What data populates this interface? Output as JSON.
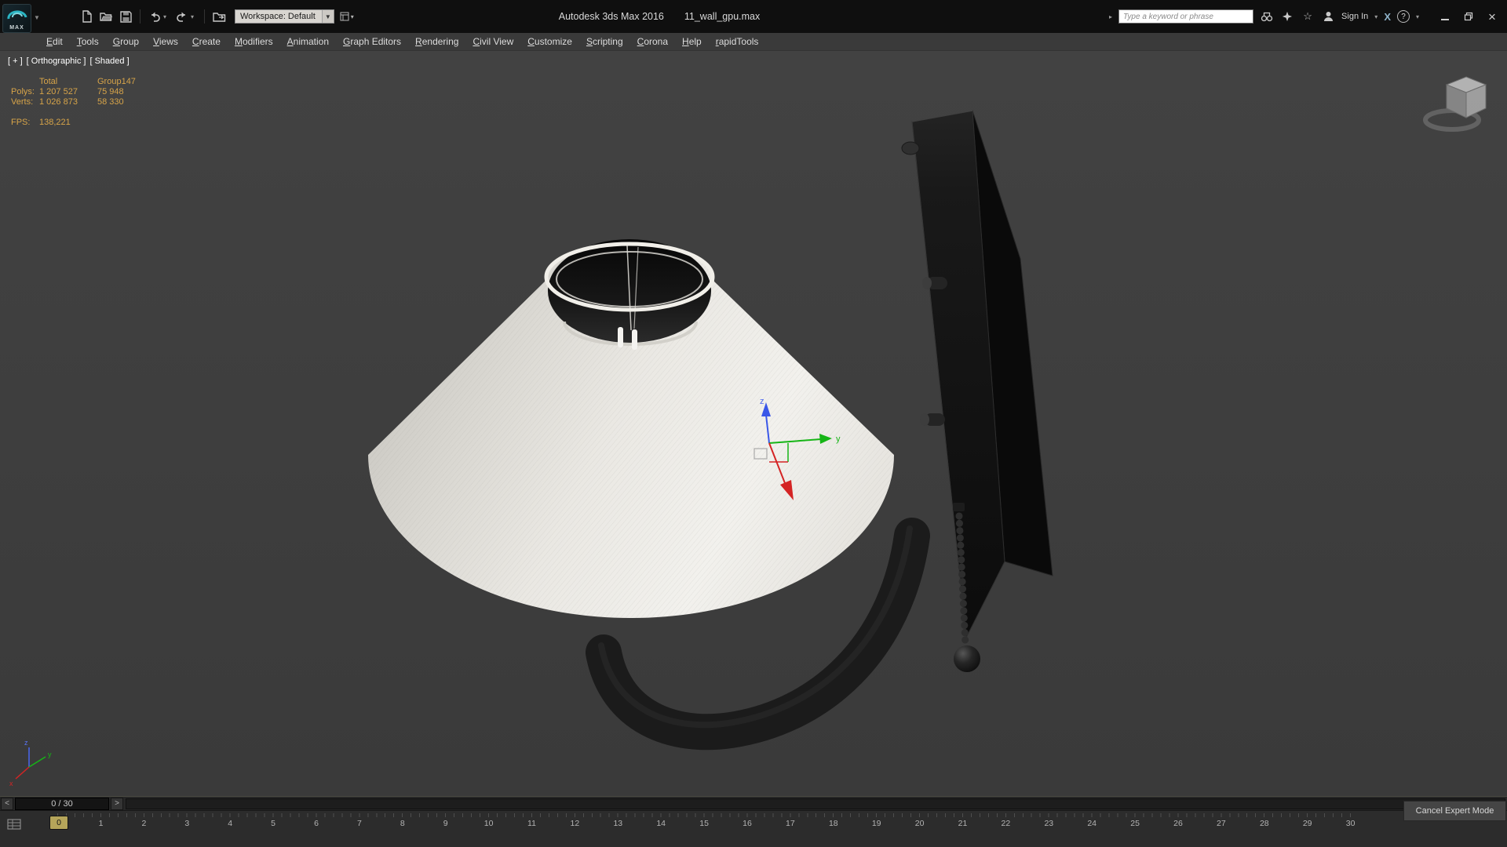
{
  "window": {
    "title": "Autodesk 3ds Max 2016",
    "document": "11_wall_gpu.max"
  },
  "title_bar": {
    "app_button_label": "MAX",
    "workspace_label": "Workspace: Default",
    "search_placeholder": "Type a keyword or phrase",
    "sign_in_label": "Sign In",
    "exchange_label": "X",
    "help_label": "?"
  },
  "menu_bar": {
    "items": [
      {
        "label": "Edit"
      },
      {
        "label": "Tools"
      },
      {
        "label": "Group"
      },
      {
        "label": "Views"
      },
      {
        "label": "Create"
      },
      {
        "label": "Modifiers"
      },
      {
        "label": "Animation"
      },
      {
        "label": "Graph Editors"
      },
      {
        "label": "Rendering"
      },
      {
        "label": "Civil View"
      },
      {
        "label": "Customize"
      },
      {
        "label": "Scripting"
      },
      {
        "label": "Corona"
      },
      {
        "label": "Help"
      },
      {
        "label": "rapidTools"
      }
    ]
  },
  "viewport": {
    "label": {
      "menu": "[ + ]",
      "view": "[ Orthographic ]",
      "shading": "[ Shaded ]"
    },
    "stats": {
      "columns": {
        "total": "Total",
        "selection": "Group147"
      },
      "rows": [
        {
          "label": "Polys:",
          "total": "1 207 527",
          "selection": "75 948"
        },
        {
          "label": "Verts:",
          "total": "1 026 873",
          "selection": "58 330"
        }
      ],
      "fps_label": "FPS:",
      "fps_value": "138,221"
    },
    "gizmo": {
      "axis_y_label": "y",
      "axis_z_label": "z"
    },
    "world_axis": {
      "x": "x",
      "y": "y",
      "z": "z"
    }
  },
  "timeline": {
    "prev_label": "<",
    "next_label": ">",
    "frame_display": "0 / 30",
    "current_frame": "0",
    "frame_numbers": [
      "1",
      "2",
      "3",
      "4",
      "5",
      "6",
      "7",
      "8",
      "9",
      "10",
      "11",
      "12",
      "13",
      "14",
      "15",
      "16",
      "17",
      "18",
      "19",
      "20",
      "21",
      "22",
      "23",
      "24",
      "25",
      "26",
      "27",
      "28",
      "29",
      "30"
    ]
  },
  "status_bar": {
    "cancel_expert_label": "Cancel Expert Mode"
  },
  "colors": {
    "stats_text": "#d7a449",
    "axis_x": "#d42424",
    "axis_y": "#16b516",
    "axis_z": "#3a57e8",
    "slider": "#b5a55a",
    "viewport_bg": "#3d3d3d"
  }
}
